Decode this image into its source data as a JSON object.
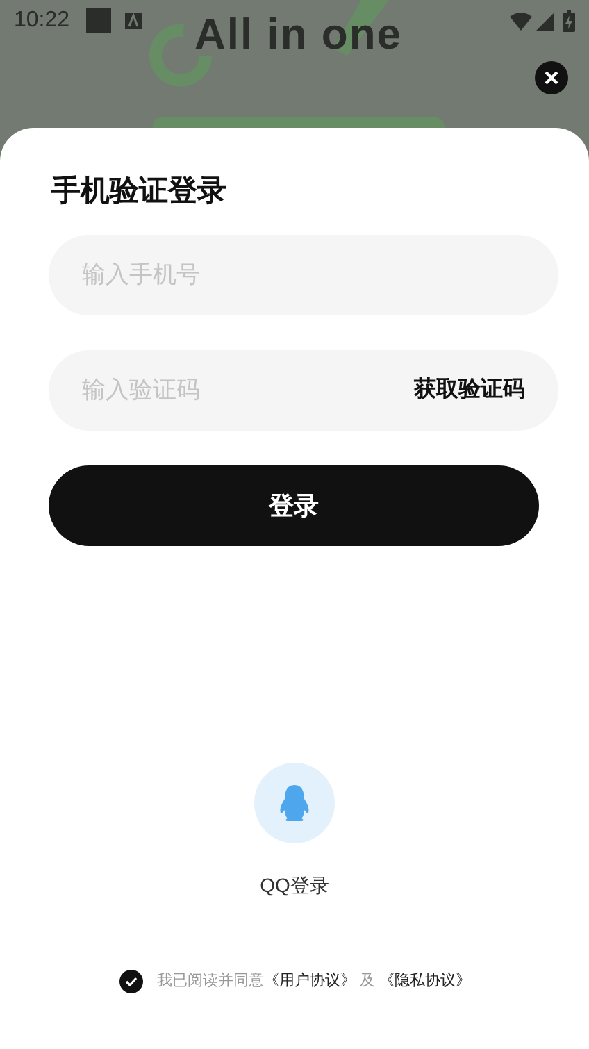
{
  "status_bar": {
    "time": "10:22"
  },
  "background_app": {
    "title": "All in one"
  },
  "login_sheet": {
    "title": "手机验证登录",
    "phone_field": {
      "placeholder": "输入手机号"
    },
    "code_field": {
      "placeholder": "输入验证码",
      "action": "获取验证码"
    },
    "login_button": "登录",
    "qq_login": {
      "label": "QQ登录"
    },
    "agreement": {
      "checked": true,
      "text": "我已阅读并同意",
      "user_agreement": "《用户协议》",
      "conjunction": "及",
      "privacy_policy": "《隐私协议》"
    }
  }
}
